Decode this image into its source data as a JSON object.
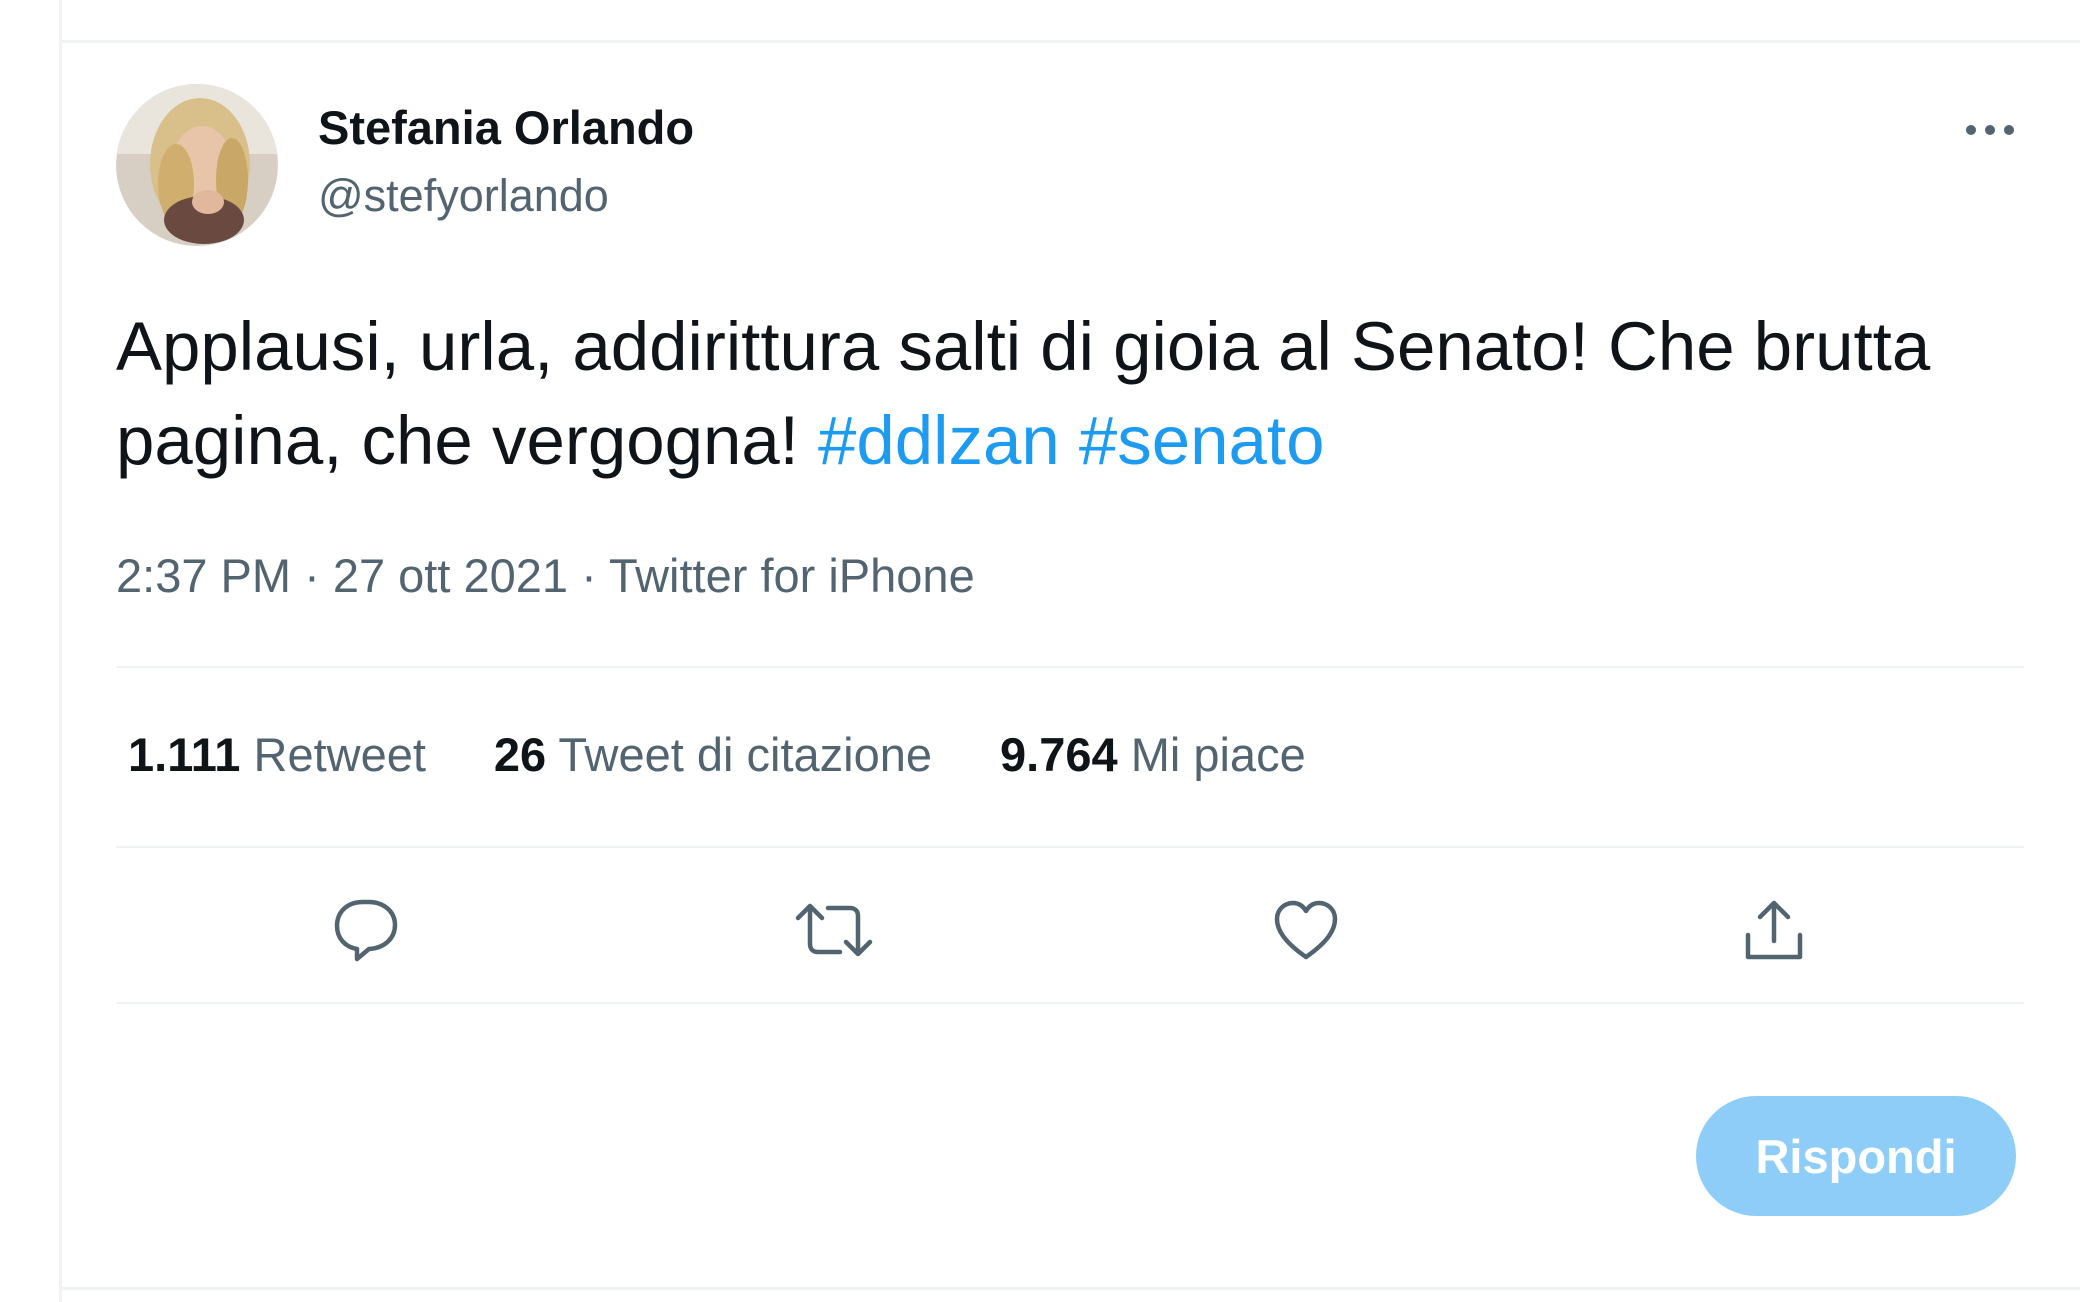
{
  "tweet": {
    "author": {
      "display_name": "Stefania Orlando",
      "handle": "@stefyorlando"
    },
    "text_main": "Applausi, urla, addirittura salti di gioia al Senato! Che brutta pagina, che vergogna!",
    "hashtags": [
      "#ddlzan",
      "#senato"
    ],
    "time": "2:37 PM",
    "separator": "·",
    "date": "27 ott 2021",
    "source": "Twitter for iPhone",
    "stats": [
      {
        "number": "1.111",
        "label": "Retweet"
      },
      {
        "number": "26",
        "label": "Tweet di citazione"
      },
      {
        "number": "9.764",
        "label": "Mi piace"
      }
    ],
    "reply_button_label": "Rispondi"
  },
  "icons": {
    "more": "more-horizontal-icon",
    "reply": "comment-icon",
    "retweet": "retweet-icon",
    "like": "heart-icon",
    "share": "share-icon"
  },
  "colors": {
    "link": "#1d9bf0",
    "text": "#0f1419",
    "secondary": "#536471",
    "reply_button": "#8ecdf8"
  }
}
